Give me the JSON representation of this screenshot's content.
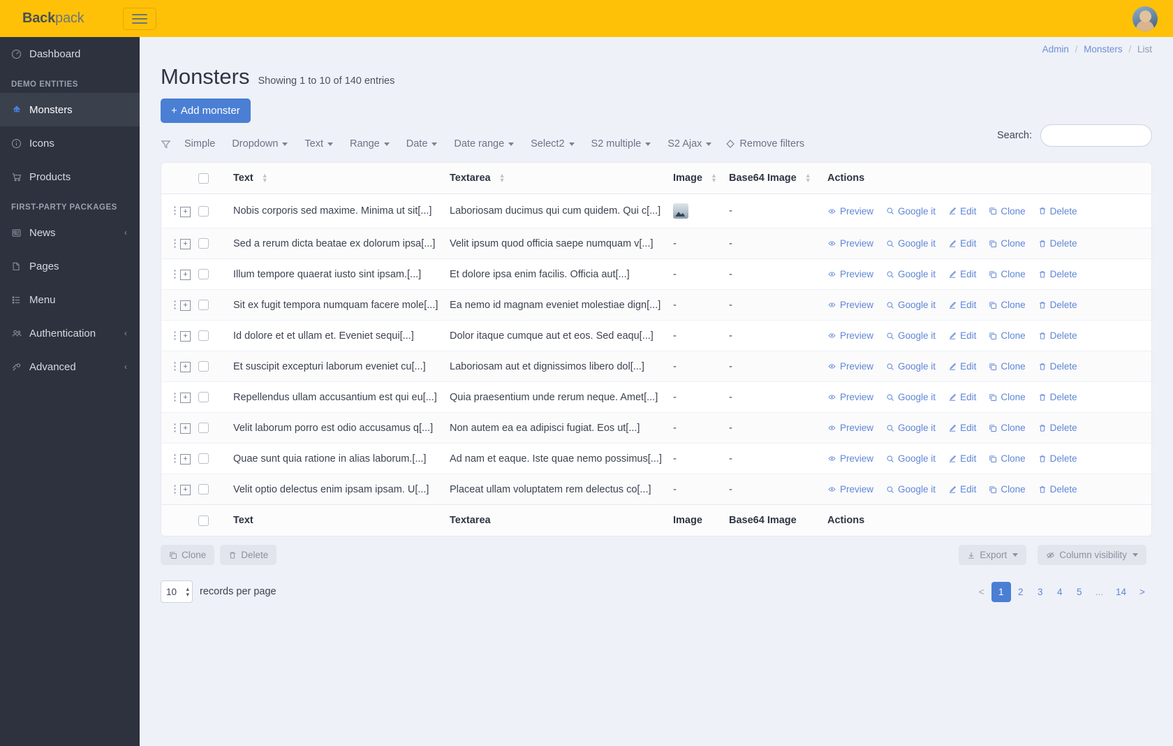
{
  "topbar": {
    "brand_bold": "Back",
    "brand_light": "pack",
    "menu_toggle": "menu-toggle"
  },
  "sidebar": {
    "dashboard": {
      "label": "Dashboard",
      "icon": "dashboard-icon"
    },
    "sections": [
      {
        "heading": "DEMO ENTITIES",
        "items": [
          {
            "label": "Monsters",
            "icon": "monster-icon",
            "active": true,
            "caret": ""
          },
          {
            "label": "Icons",
            "icon": "info-icon",
            "active": false,
            "caret": ""
          },
          {
            "label": "Products",
            "icon": "cart-icon",
            "active": false,
            "caret": ""
          }
        ]
      },
      {
        "heading": "FIRST-PARTY PACKAGES",
        "items": [
          {
            "label": "News",
            "icon": "news-icon",
            "active": false,
            "caret": "‹"
          },
          {
            "label": "Pages",
            "icon": "page-icon",
            "active": false,
            "caret": ""
          },
          {
            "label": "Menu",
            "icon": "list-icon",
            "active": false,
            "caret": ""
          },
          {
            "label": "Authentication",
            "icon": "users-icon",
            "active": false,
            "caret": "‹"
          },
          {
            "label": "Advanced",
            "icon": "settings-icon",
            "active": false,
            "caret": "‹"
          }
        ]
      }
    ]
  },
  "breadcrumb": {
    "admin": "Admin",
    "entity": "Monsters",
    "current": "List",
    "sep": "/"
  },
  "header": {
    "title": "Monsters",
    "subtitle": "Showing 1 to 10 of 140 entries",
    "add_button": "Add monster",
    "add_plus": "+"
  },
  "search": {
    "label": "Search:",
    "value": "",
    "placeholder": ""
  },
  "filters": {
    "icon": "filter-icon",
    "items": [
      {
        "label": "Simple",
        "caret": false
      },
      {
        "label": "Dropdown",
        "caret": true
      },
      {
        "label": "Text",
        "caret": true
      },
      {
        "label": "Range",
        "caret": true
      },
      {
        "label": "Date",
        "caret": true
      },
      {
        "label": "Date range",
        "caret": true
      },
      {
        "label": "Select2",
        "caret": true
      },
      {
        "label": "S2 multiple",
        "caret": true
      },
      {
        "label": "S2 Ajax",
        "caret": true
      }
    ],
    "remove": "Remove filters"
  },
  "table": {
    "columns": [
      {
        "label": "Text",
        "sortable": true
      },
      {
        "label": "Textarea",
        "sortable": true
      },
      {
        "label": "Image",
        "sortable": true
      },
      {
        "label": "Base64 Image",
        "sortable": true
      },
      {
        "label": "Actions",
        "sortable": false
      }
    ],
    "actions": [
      {
        "label": "Preview",
        "icon": "eye-icon"
      },
      {
        "label": "Google it",
        "icon": "search-icon"
      },
      {
        "label": "Edit",
        "icon": "edit-icon"
      },
      {
        "label": "Clone",
        "icon": "clone-icon"
      },
      {
        "label": "Delete",
        "icon": "trash-icon"
      }
    ],
    "rows": [
      {
        "text": "Nobis corporis sed maxime. Minima ut sit[...]",
        "textarea": "Laboriosam ducimus qui cum quidem. Qui c[...]",
        "image": "thumbnail",
        "base64": "-"
      },
      {
        "text": "Sed a rerum dicta beatae ex dolorum ipsa[...]",
        "textarea": "Velit ipsum quod officia saepe numquam v[...]",
        "image": "-",
        "base64": "-"
      },
      {
        "text": "Illum tempore quaerat iusto sint ipsam.[...]",
        "textarea": "Et dolore ipsa enim facilis. Officia aut[...]",
        "image": "-",
        "base64": "-"
      },
      {
        "text": "Sit ex fugit tempora numquam facere mole[...]",
        "textarea": "Ea nemo id magnam eveniet molestiae dign[...]",
        "image": "-",
        "base64": "-"
      },
      {
        "text": "Id dolore et et ullam et. Eveniet sequi[...]",
        "textarea": "Dolor itaque cumque aut et eos. Sed eaqu[...]",
        "image": "-",
        "base64": "-"
      },
      {
        "text": "Et suscipit excepturi laborum eveniet cu[...]",
        "textarea": "Laboriosam aut et dignissimos libero dol[...]",
        "image": "-",
        "base64": "-"
      },
      {
        "text": "Repellendus ullam accusantium est qui eu[...]",
        "textarea": "Quia praesentium unde rerum neque. Amet[...]",
        "image": "-",
        "base64": "-"
      },
      {
        "text": "Velit laborum porro est odio accusamus q[...]",
        "textarea": "Non autem ea ea adipisci fugiat. Eos ut[...]",
        "image": "-",
        "base64": "-"
      },
      {
        "text": "Quae sunt quia ratione in alias laborum.[...]",
        "textarea": "Ad nam et eaque. Iste quae nemo possimus[...]",
        "image": "-",
        "base64": "-"
      },
      {
        "text": "Velit optio delectus enim ipsam ipsam. U[...]",
        "textarea": "Placeat ullam voluptatem rem delectus co[...]",
        "image": "-",
        "base64": "-"
      }
    ]
  },
  "footer": {
    "clone": "Clone",
    "delete": "Delete",
    "export": "Export",
    "column_visibility": "Column visibility"
  },
  "pagination": {
    "per_page_value": "10",
    "per_page_label": "records per page",
    "prev": "<",
    "next": ">",
    "ellipsis": "...",
    "pages": [
      "1",
      "2",
      "3",
      "4",
      "5"
    ],
    "last_page": "14",
    "active_page": "1"
  },
  "colors": {
    "brand_yellow": "#ffc107",
    "sidebar": "#2d323e",
    "accent_blue": "#4a7fd4",
    "link_blue": "#5f86d6",
    "page_bg": "#eef1f8"
  }
}
